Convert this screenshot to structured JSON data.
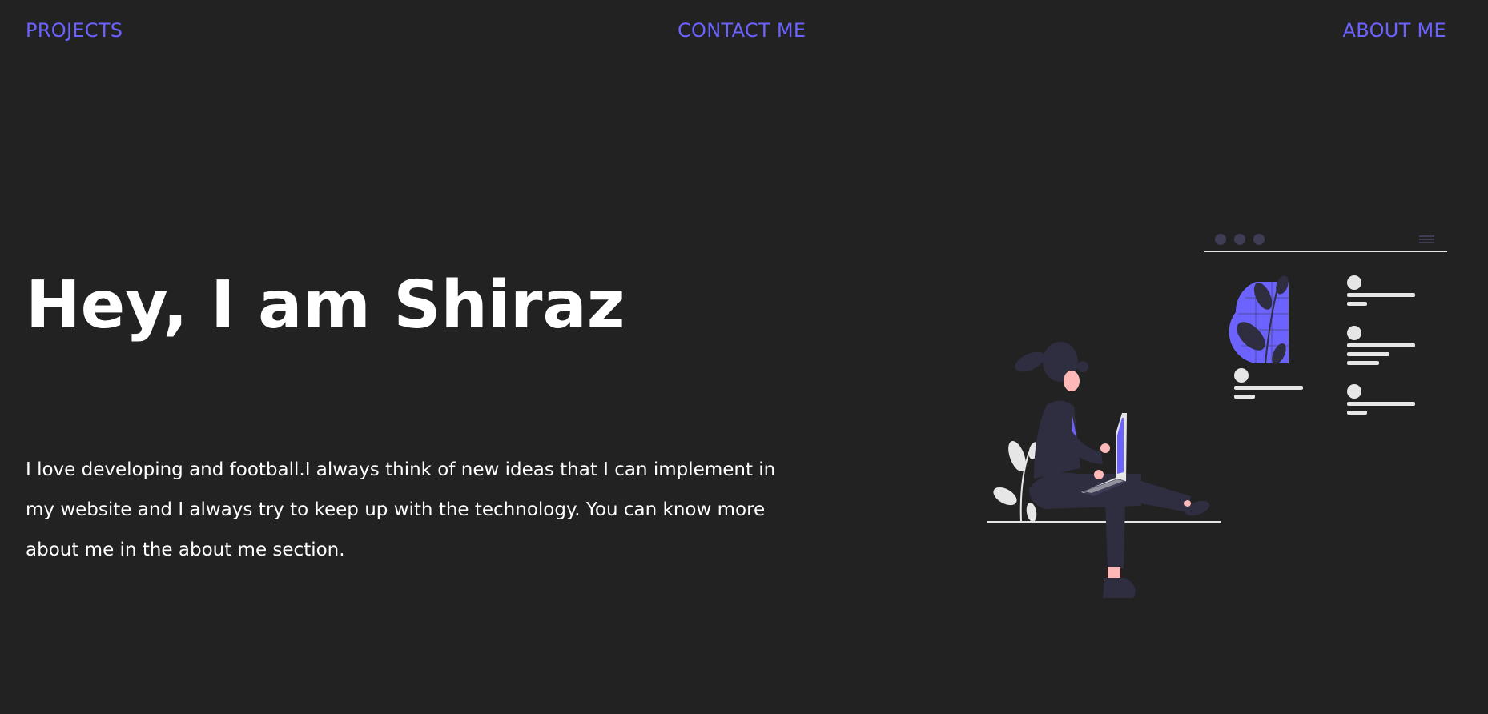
{
  "nav": {
    "projects": "PROJECTS",
    "contact": "CONTACT ME",
    "about": "ABOUT ME"
  },
  "hero": {
    "title": "Hey, I am Shiraz",
    "description": "I love developing and football.I always think of new ideas that I can implement in my website and I always try to keep up with the technology. You can know more about me in the about me section."
  },
  "illustration": {
    "name": "woman-with-laptop-illustration"
  },
  "colors": {
    "background": "#222222",
    "accent": "#6c63ff",
    "text": "#ffffff",
    "figure_dark": "#2f2e41",
    "skin": "#ffb8b8",
    "light_gray": "#e6e6e6"
  }
}
